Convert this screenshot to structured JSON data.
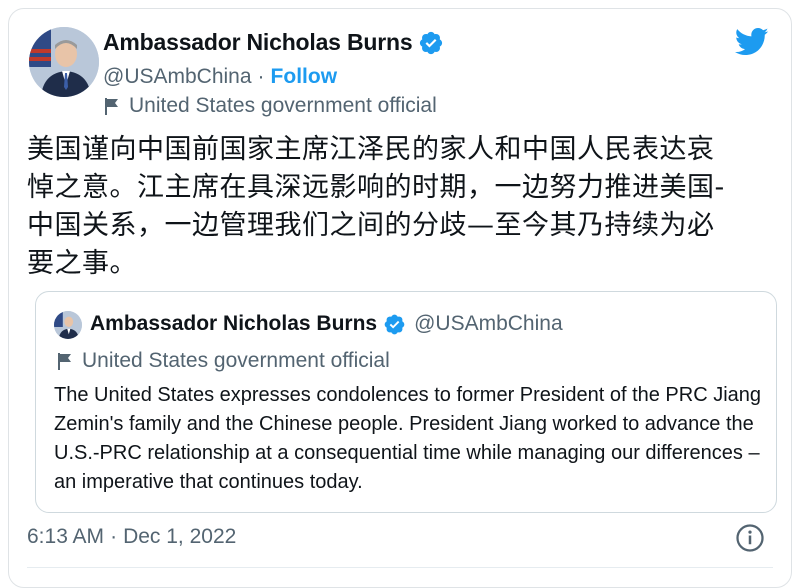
{
  "author": {
    "name": "Ambassador Nicholas Burns",
    "handle": "@USAmbChina",
    "separator": "·",
    "follow_label": "Follow",
    "label": "United States government official"
  },
  "tweet": {
    "text": "美国谨向中国前国家主席江泽民的家人和中国人民表达哀\n悼之意。江主席在具深远影响的时期，一边努力推进美国-\n中国关系，一边管理我们之间的分歧—至今其乃持续为必\n要之事。",
    "time": "6:13 AM",
    "separator": "·",
    "date": "Dec 1, 2022"
  },
  "quoted": {
    "name": "Ambassador Nicholas Burns",
    "handle": "@USAmbChina",
    "label": "United States government official",
    "text": "The United States expresses condolences to former President of the PRC Jiang Zemin's family and the Chinese people. President Jiang worked to advance the U.S.-PRC relationship at a consequential time while managing our differences – an imperative that continues today."
  },
  "icons": {
    "verified": "verified-badge-icon",
    "flag": "flag-icon",
    "brand": "twitter-bird-icon",
    "info": "info-icon"
  },
  "colors": {
    "accent": "#1d9bf0",
    "text": "#0f1419",
    "muted": "#536471",
    "border": "#cfd9de"
  }
}
